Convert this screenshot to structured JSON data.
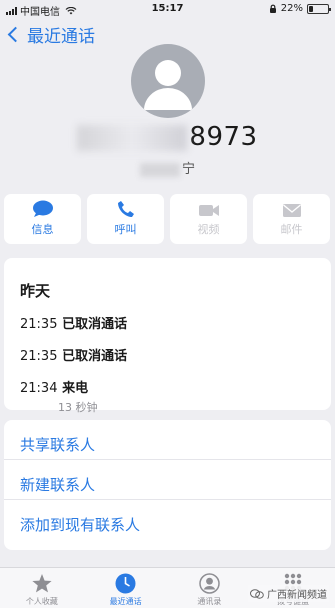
{
  "status_bar": {
    "carrier": "中国电信",
    "time": "15:17",
    "battery": "22%",
    "battery_level": 0.22
  },
  "nav": {
    "back_label": "最近通话"
  },
  "contact": {
    "number_visible": "8973",
    "location_visible": "宁"
  },
  "actions": [
    {
      "label": "信息",
      "icon": "message-icon",
      "enabled": true
    },
    {
      "label": "呼叫",
      "icon": "phone-icon",
      "enabled": true
    },
    {
      "label": "视频",
      "icon": "video-icon",
      "enabled": false
    },
    {
      "label": "邮件",
      "icon": "mail-icon",
      "enabled": false
    }
  ],
  "recents": {
    "day": "昨天",
    "calls": [
      {
        "time": "21:35",
        "status": "已取消通话",
        "duration": ""
      },
      {
        "time": "21:35",
        "status": "已取消通话",
        "duration": ""
      },
      {
        "time": "21:34",
        "status": "来电",
        "duration": "13 秒钟"
      }
    ]
  },
  "links": [
    {
      "label": "共享联系人"
    },
    {
      "label": "新建联系人"
    },
    {
      "label": "添加到现有联系人"
    }
  ],
  "tab_bar": [
    {
      "label": "个人收藏",
      "icon": "star-icon",
      "active": false
    },
    {
      "label": "最近通话",
      "icon": "clock-icon",
      "active": true
    },
    {
      "label": "通讯录",
      "icon": "contacts-icon",
      "active": false
    },
    {
      "label": "拨号键盘",
      "icon": "keypad-icon",
      "active": false
    }
  ],
  "watermark": {
    "text": "广西新闻频道"
  },
  "colors": {
    "accent": "#2a7ae2",
    "disabled": "#c7c7cc",
    "background": "#eeeef2"
  }
}
